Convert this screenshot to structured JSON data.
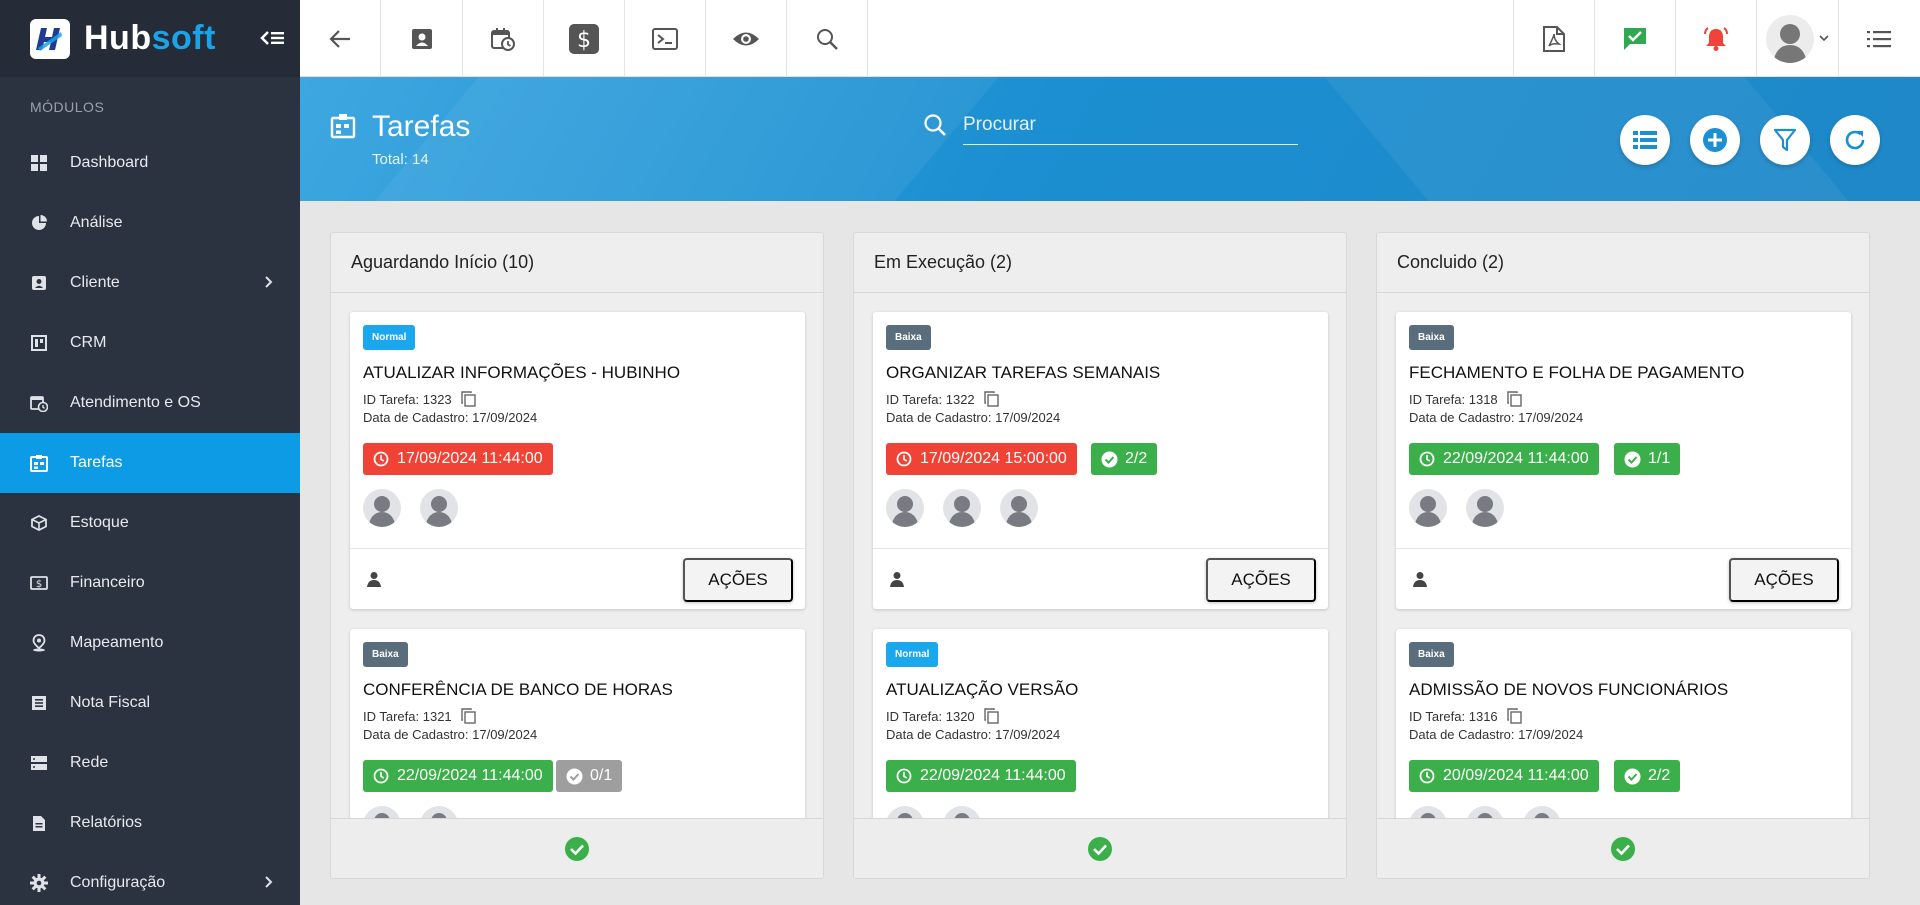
{
  "app": {
    "logo_hub": "Hub",
    "logo_soft": "soft"
  },
  "sidebar": {
    "section_label": "MÓDULOS",
    "items": [
      {
        "label": "Dashboard",
        "icon": "dashboard-icon"
      },
      {
        "label": "Análise",
        "icon": "pie-chart-icon"
      },
      {
        "label": "Cliente",
        "icon": "contact-card-icon",
        "has_submenu": true
      },
      {
        "label": "CRM",
        "icon": "board-icon"
      },
      {
        "label": "Atendimento e OS",
        "icon": "calendar-clock-icon"
      },
      {
        "label": "Tarefas",
        "icon": "tasks-icon",
        "active": true
      },
      {
        "label": "Estoque",
        "icon": "box-icon"
      },
      {
        "label": "Financeiro",
        "icon": "money-icon"
      },
      {
        "label": "Mapeamento",
        "icon": "map-pin-icon"
      },
      {
        "label": "Nota Fiscal",
        "icon": "receipt-icon"
      },
      {
        "label": "Rede",
        "icon": "server-icon"
      },
      {
        "label": "Relatórios",
        "icon": "report-icon"
      },
      {
        "label": "Configuração",
        "icon": "gear-icon",
        "has_submenu": true
      }
    ]
  },
  "header": {
    "title": "Tarefas",
    "total": "Total: 14",
    "search_placeholder": "Procurar"
  },
  "colors": {
    "accent": "#0d9be6",
    "sidebar_bg": "#2b3240",
    "red": "#f14236",
    "green": "#3bb04a",
    "priority_normal": "#1ba7ee",
    "priority_baixa": "#5a6d7d"
  },
  "columns": [
    {
      "title": "Aguardando Início (10)",
      "cards": [
        {
          "priority": "Normal",
          "priority_type": "normal",
          "title": "ATUALIZAR INFORMAÇÕES - HUBINHO",
          "id": "ID Tarefa: 1323",
          "date": "Data de Cadastro: 17/09/2024",
          "deadline": "17/09/2024 11:44:00",
          "deadline_color": "red",
          "checklist": "",
          "avatars": 2,
          "action": "AÇÕES"
        },
        {
          "priority": "Baixa",
          "priority_type": "baixa",
          "title": "CONFERÊNCIA DE BANCO DE HORAS",
          "id": "ID Tarefa: 1321",
          "date": "Data de Cadastro: 17/09/2024",
          "deadline": "22/09/2024 11:44:00",
          "deadline_color": "green",
          "checklist": "0/1",
          "checklist_color": "gray",
          "avatars": 2
        }
      ]
    },
    {
      "title": "Em Execução (2)",
      "cards": [
        {
          "priority": "Baixa",
          "priority_type": "baixa",
          "title": "ORGANIZAR TAREFAS SEMANAIS",
          "id": "ID Tarefa: 1322",
          "date": "Data de Cadastro: 17/09/2024",
          "deadline": "17/09/2024 15:00:00",
          "deadline_color": "red",
          "checklist": "2/2",
          "checklist_color": "green",
          "avatars": 3,
          "action": "AÇÕES"
        },
        {
          "priority": "Normal",
          "priority_type": "normal",
          "title": "ATUALIZAÇÃO VERSÃO",
          "id": "ID Tarefa: 1320",
          "date": "Data de Cadastro: 17/09/2024",
          "deadline": "22/09/2024 11:44:00",
          "deadline_color": "green",
          "checklist": "",
          "avatars": 2
        }
      ]
    },
    {
      "title": "Concluido (2)",
      "cards": [
        {
          "priority": "Baixa",
          "priority_type": "baixa",
          "title": "FECHAMENTO E FOLHA DE PAGAMENTO",
          "id": "ID Tarefa: 1318",
          "date": "Data de Cadastro: 17/09/2024",
          "deadline": "22/09/2024 11:44:00",
          "deadline_color": "green",
          "checklist": "1/1",
          "checklist_color": "green",
          "avatars": 2,
          "action": "AÇÕES"
        },
        {
          "priority": "Baixa",
          "priority_type": "baixa",
          "title": "ADMISSÃO DE NOVOS FUNCIONÁRIOS",
          "id": "ID Tarefa: 1316",
          "date": "Data de Cadastro: 17/09/2024",
          "deadline": "20/09/2024 11:44:00",
          "deadline_color": "green",
          "checklist": "2/2",
          "checklist_color": "green",
          "avatars": 3
        }
      ]
    }
  ]
}
